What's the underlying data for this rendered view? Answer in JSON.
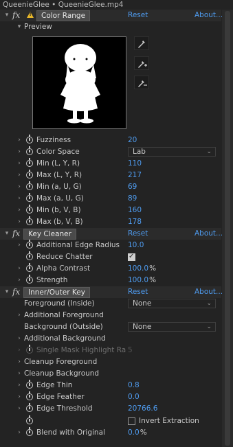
{
  "window": {
    "title": "QueenieGlee • QueenieGlee.mp4"
  },
  "color_range": {
    "name": "Color Range",
    "reset": "Reset",
    "about": "About...",
    "preview_label": "Preview",
    "props": [
      {
        "label": "Fuzziness",
        "value": "20"
      },
      {
        "label": "Color Space",
        "value": "Lab"
      },
      {
        "label": "Min (L, Y, R)",
        "value": "110"
      },
      {
        "label": "Max (L, Y, R)",
        "value": "217"
      },
      {
        "label": "Min (a, U, G)",
        "value": "69"
      },
      {
        "label": "Max (a, U, G)",
        "value": "89"
      },
      {
        "label": "Min (b, V, B)",
        "value": "160"
      },
      {
        "label": "Max (b, V, B)",
        "value": "178"
      }
    ]
  },
  "key_cleaner": {
    "name": "Key Cleaner",
    "reset": "Reset",
    "about": "About...",
    "props": [
      {
        "label": "Additional Edge Radius",
        "value": "10.0"
      },
      {
        "label": "Reduce Chatter",
        "checked": true
      },
      {
        "label": "Alpha Contrast",
        "value": "100.0",
        "unit": "%"
      },
      {
        "label": "Strength",
        "value": "100.0",
        "unit": "%"
      }
    ]
  },
  "inner_outer_key": {
    "name": "Inner/Outer Key",
    "reset": "Reset",
    "about": "About...",
    "props": [
      {
        "label": "Foreground (Inside)",
        "value": "None"
      },
      {
        "label": "Additional Foreground"
      },
      {
        "label": "Background (Outside)",
        "value": "None"
      },
      {
        "label": "Additional Background"
      },
      {
        "label": "Single Mask Highlight Ra",
        "value": "5"
      },
      {
        "label": "Cleanup Foreground"
      },
      {
        "label": "Cleanup Background"
      },
      {
        "label": "Edge Thin",
        "value": "0.8"
      },
      {
        "label": "Edge Feather",
        "value": "0.0"
      },
      {
        "label": "Edge Threshold",
        "value": "20766.6"
      },
      {
        "label": "Invert Extraction",
        "checked": false
      },
      {
        "label": "Blend with Original",
        "value": "0.0",
        "unit": "%"
      }
    ]
  },
  "icons": {
    "eyedropper": "eyedropper-icon",
    "eyedropper_add": "eyedropper-plus-icon",
    "eyedropper_subtract": "eyedropper-minus-icon",
    "stopwatch": "stopwatch-icon",
    "warning": "warning-icon"
  },
  "colors": {
    "link": "#4f9cf0",
    "background": "#232323",
    "warning": "#e8b72a"
  }
}
